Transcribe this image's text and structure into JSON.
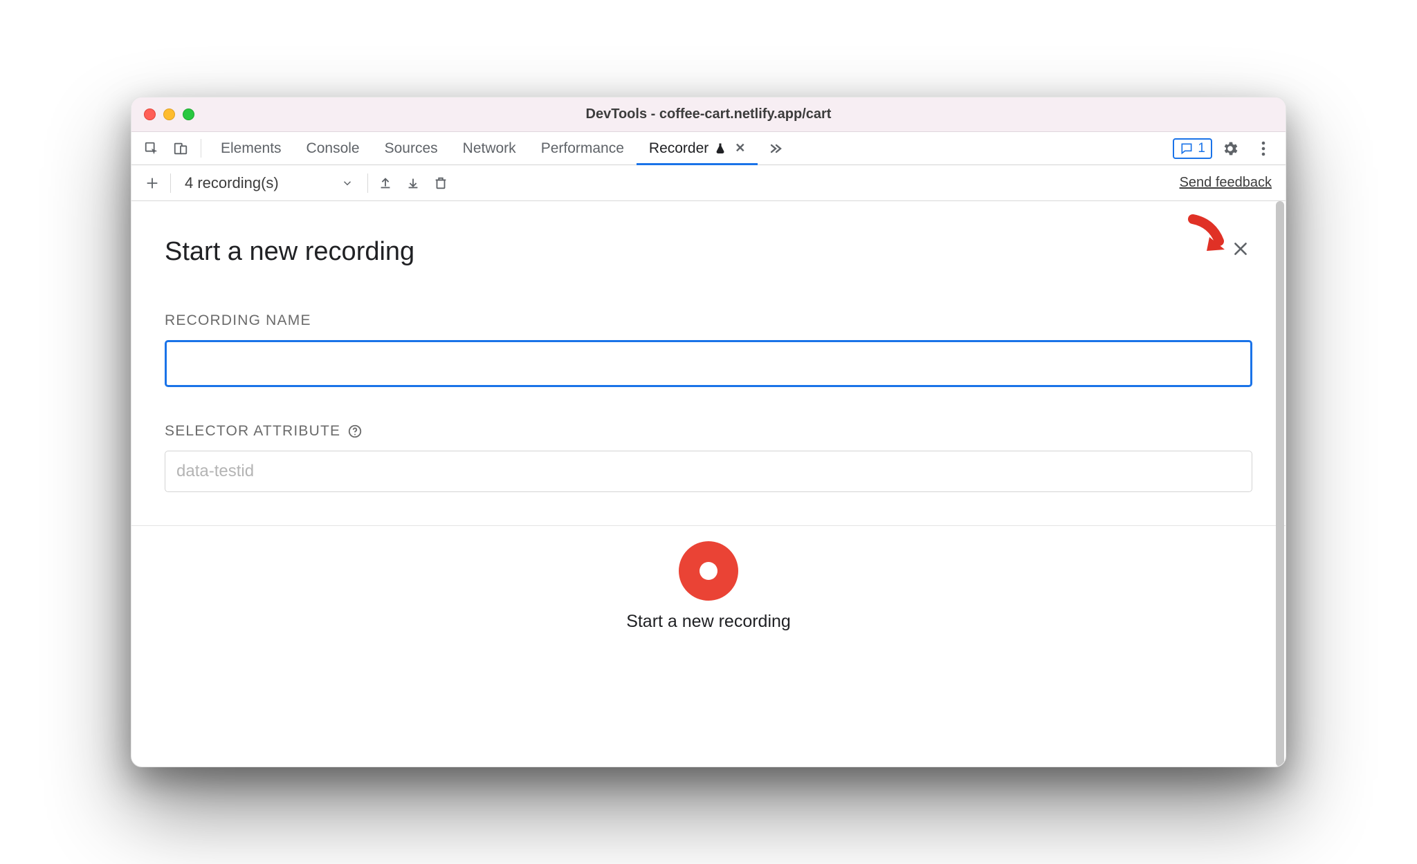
{
  "window": {
    "title": "DevTools - coffee-cart.netlify.app/cart"
  },
  "tabs": {
    "items": [
      {
        "label": "Elements"
      },
      {
        "label": "Console"
      },
      {
        "label": "Sources"
      },
      {
        "label": "Network"
      },
      {
        "label": "Performance"
      },
      {
        "label": "Recorder"
      }
    ],
    "active_index": 5,
    "issues_count": "1"
  },
  "toolbar": {
    "recordings_label": "4 recording(s)",
    "feedback_label": "Send feedback"
  },
  "panel": {
    "heading": "Start a new recording",
    "recording_name_label": "RECORDING NAME",
    "recording_name_value": "",
    "selector_attr_label": "SELECTOR ATTRIBUTE",
    "selector_attr_placeholder": "data-testid",
    "selector_attr_value": "",
    "record_button_label": "Start a new recording"
  },
  "colors": {
    "accent": "#1a73e8",
    "record": "#ea4335",
    "annotation": "#e03126"
  }
}
